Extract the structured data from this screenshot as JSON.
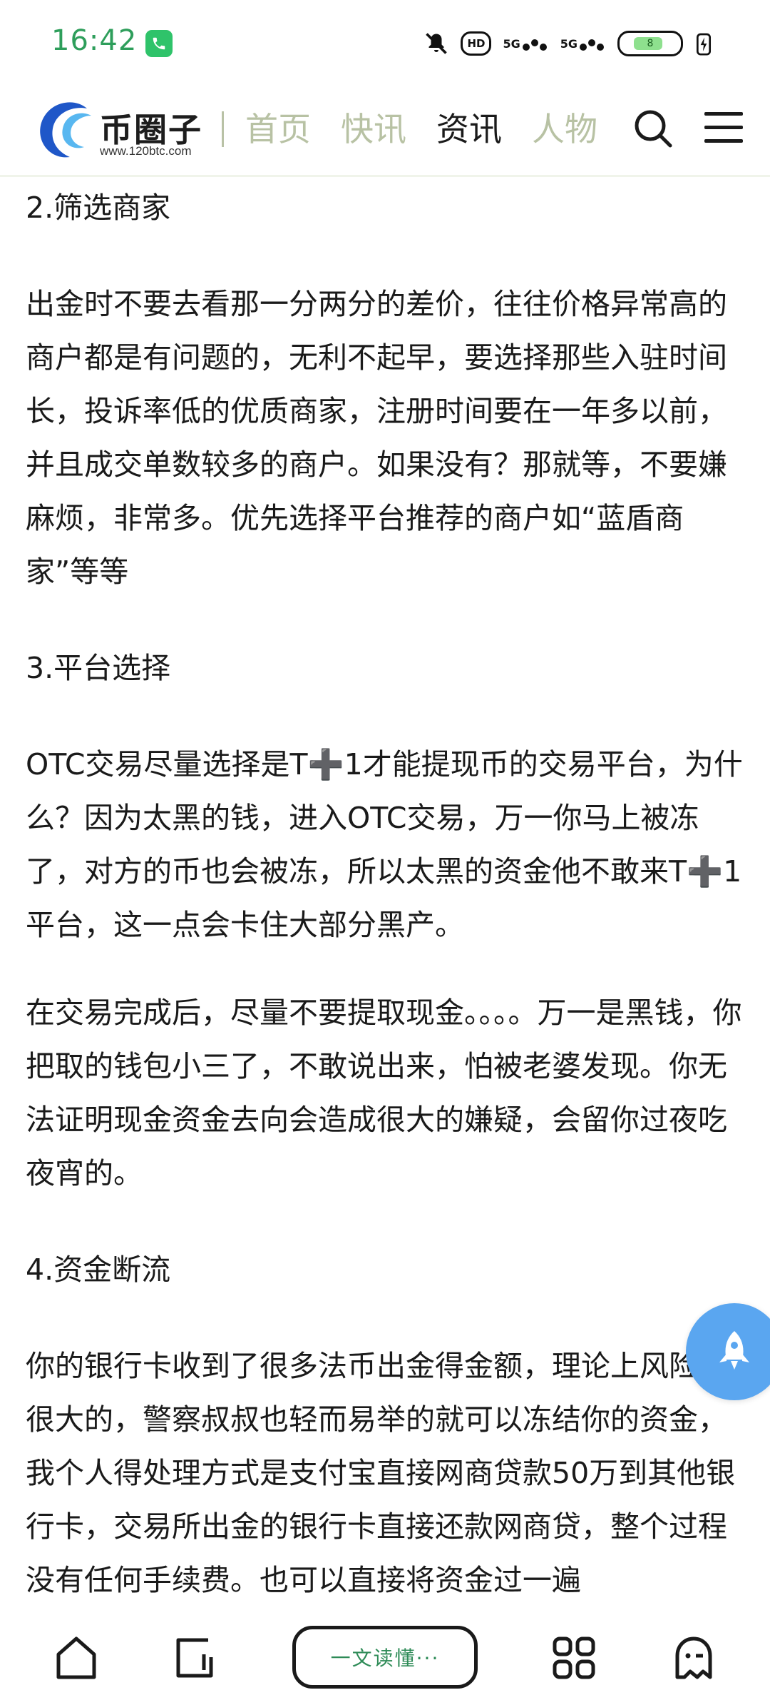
{
  "status_bar": {
    "time": "16:42",
    "signal_1": "5G",
    "signal_2": "5G",
    "hd_label": "HD",
    "battery_level": "8"
  },
  "nav": {
    "logo_text": "币圈子",
    "logo_url": "www.120btc.com",
    "links": [
      {
        "label": "首页",
        "active": false
      },
      {
        "label": "快讯",
        "active": false
      },
      {
        "label": "资讯",
        "active": true
      },
      {
        "label": "人物",
        "active": false
      }
    ]
  },
  "article": {
    "paragraphs": [
      "2.筛选商家",
      "出金时不要去看那一分两分的差价，往往价格异常高的商户都是有问题的，无利不起早，要选择那些入驻时间长，投诉率低的优质商家，注册时间要在一年多以前，并且成交单数较多的商户。如果没有？那就等，不要嫌麻烦，非常多。优先选择平台推荐的商户如“蓝盾商家”等等",
      "3.平台选择",
      "OTC交易尽量选择是T➕1才能提现币的交易平台，为什么？因为太黑的钱，进入OTC交易，万一你马上被冻了，对方的币也会被冻，所以太黑的资金他不敢来T➕1平台，这一点会卡住大部分黑产。",
      "在交易完成后，尽量不要提取现金。。。。万一是黑钱，你把取的钱包小三了，不敢说出来，怕被老婆发现。你无法证明现金资金去向会造成很大的嫌疑，会留你过夜吃夜宵的。",
      "4.资金断流",
      "你的银行卡收到了很多法币出金得金额，理论上风险是很大的，警察叔叔也轻而易举的就可以冻结你的资金，我个人得处理方式是支付宝直接网商贷款50万到其他银行卡，交易所出金的银行卡直接还款网商贷，整个过程没有任何手续费。也可以直接将资金过一遍"
    ]
  },
  "bottom_bar": {
    "summary_label": "一文读懂···"
  },
  "colors": {
    "time_green": "#2e9e5b",
    "nav_inactive": "#b8c2a4",
    "rocket_blue": "#5aa6f0",
    "summary_green": "#2e8b57"
  }
}
